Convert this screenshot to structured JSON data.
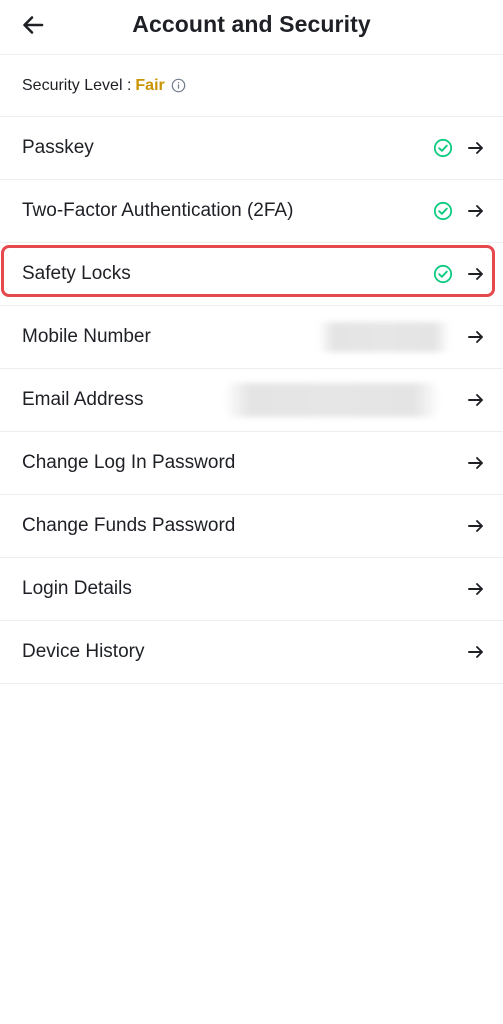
{
  "header": {
    "title": "Account and Security",
    "back_icon": "arrow-left-icon"
  },
  "security_level": {
    "label": "Security Level :",
    "value": "Fair",
    "value_color": "#C99400",
    "info_icon": "info-icon"
  },
  "items": [
    {
      "label": "Passkey",
      "verified": true
    },
    {
      "label": "Two-Factor Authentication (2FA)",
      "verified": true
    },
    {
      "label": "Safety Locks",
      "verified": true,
      "highlighted": true
    },
    {
      "label": "Mobile Number",
      "verified": false,
      "value_redacted": true
    },
    {
      "label": "Email Address",
      "verified": false,
      "value_redacted": true
    },
    {
      "label": "Change Log In Password",
      "verified": false
    },
    {
      "label": "Change Funds Password",
      "verified": false
    },
    {
      "label": "Login Details",
      "verified": false
    },
    {
      "label": "Device History",
      "verified": false
    }
  ],
  "colors": {
    "text": "#1E2026",
    "check": "#0ECB81",
    "highlight_border": "#E5484D",
    "divider": "#EEEEEE"
  }
}
